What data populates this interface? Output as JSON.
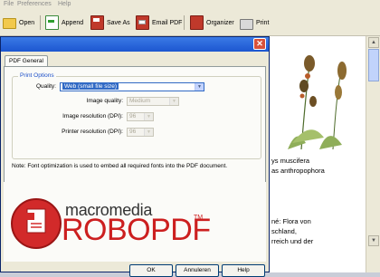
{
  "menu": {
    "items": [
      "File",
      "Preferences",
      "Help"
    ]
  },
  "toolbar": {
    "buttons": [
      {
        "label": "Open",
        "icon": "folder-open-icon"
      },
      {
        "label": "Append",
        "icon": "append-icon"
      },
      {
        "label": "Save As",
        "icon": "save-icon"
      },
      {
        "label": "Email PDF",
        "icon": "email-icon"
      },
      {
        "label": "Organizer",
        "icon": "organizer-icon"
      },
      {
        "label": "Print",
        "icon": "printer-icon"
      }
    ]
  },
  "background_doc": {
    "lines": [
      "ys muscifera",
      "as anthropophora",
      "né: Flora von",
      "schland,",
      "rreich und der"
    ]
  },
  "dialog": {
    "tab": "PDF General",
    "group_title": "Print Options",
    "quality_label": "Quality:",
    "quality_value": "Web (small file size)",
    "image_quality_label": "Image quality:",
    "image_quality_value": "Medium",
    "image_resolution_label": "Image resolution (DPI):",
    "image_resolution_value": "96",
    "printer_resolution_label": "Printer resolution (DPI):",
    "printer_resolution_value": "96",
    "note": "Note: Font optimization is used to embed all required fonts into the PDF document.",
    "logo_brand": "macromedia",
    "logo_product": "ROBOPDF",
    "logo_tm": "TM",
    "buttons": {
      "ok": "OK",
      "cancel": "Annuleren",
      "help": "Help"
    },
    "close_symbol": "✕"
  },
  "colors": {
    "accent": "#316ac5",
    "brand_red": "#cc1f1f",
    "title_blue": "#1c56d0"
  }
}
